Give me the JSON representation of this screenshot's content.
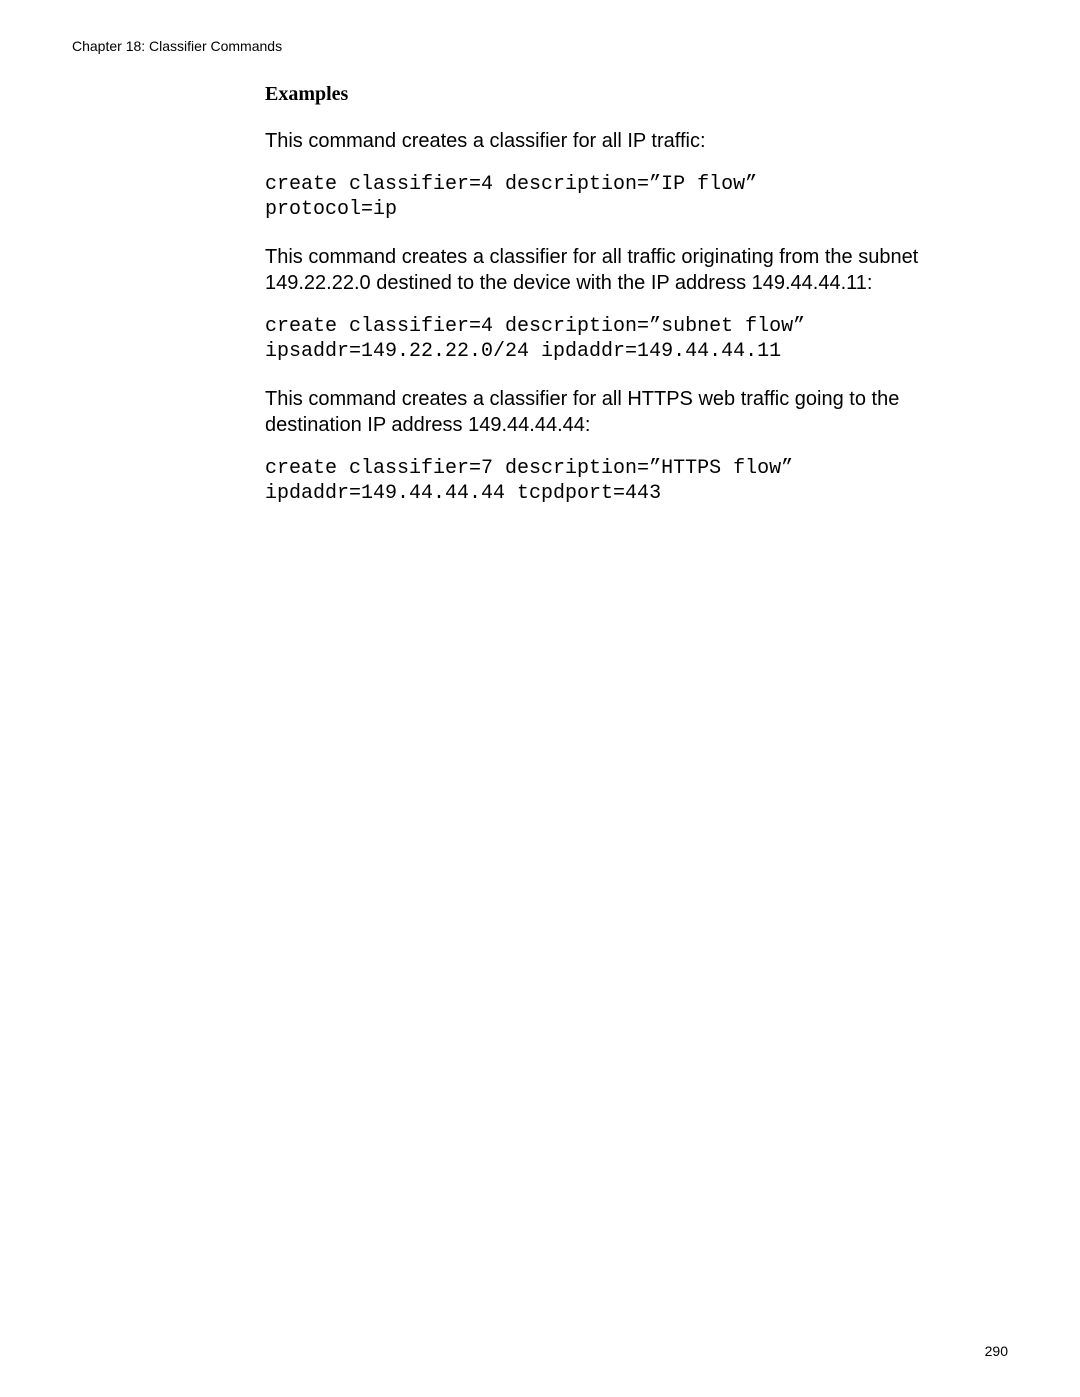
{
  "header": {
    "chapter": "Chapter 18: Classifier Commands"
  },
  "section": {
    "heading": "Examples",
    "para1": "This command creates a classifier for all IP traffic:",
    "code1": "create classifier=4 description=”IP flow”\nprotocol=ip",
    "para2": "This command creates a classifier for all traffic originating from the subnet 149.22.22.0 destined to the device with the IP address 149.44.44.11:",
    "code2": "create classifier=4 description=”subnet flow”\nipsaddr=149.22.22.0/24 ipdaddr=149.44.44.11",
    "para3": "This command creates a classifier for all HTTPS web traffic going to the destination IP address 149.44.44.44:",
    "code3": "create classifier=7 description=”HTTPS flow”\nipdaddr=149.44.44.44 tcpdport=443"
  },
  "footer": {
    "page": "290"
  }
}
